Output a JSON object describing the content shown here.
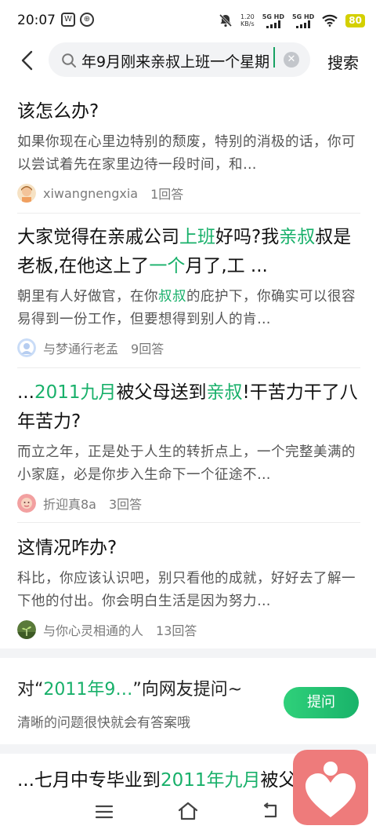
{
  "status_bar": {
    "time": "20:07",
    "speed_value": "1.20",
    "speed_unit": "KB/s",
    "sim1_label": "5G HD",
    "sim2_label": "5G HD",
    "battery": "80"
  },
  "search": {
    "query": "年9月刚来亲叔上班一个星期",
    "button_label": "搜索"
  },
  "results": [
    {
      "title": "该怎么办?",
      "summary": "如果你现在心里边特别的颓废，特别的消极的话，你可以尝试着先在家里边待一段时间，和…",
      "author": "xiwangnengxia",
      "answers": "1回答"
    },
    {
      "title_parts": [
        "大家觉得在亲戚公司",
        "上班",
        "好吗?我",
        "亲叔",
        "叔是老板,在他这上了",
        "一个",
        "月了,工 ..."
      ],
      "summary_parts": [
        "朝里有人好做官，在你",
        "叔叔",
        "的庇护下，你确实可以很容易得到一份工作，但要想得到别人的肯…"
      ],
      "author": "与梦通行老孟",
      "answers": "9回答"
    },
    {
      "title_parts": [
        "...",
        "2011九月",
        "被父母送到",
        "亲叔",
        "!干苦力干了八年苦力?"
      ],
      "summary": "而立之年，正是处于人生的转折点上，一个完整美满的小家庭，必是你步入生命下一个征途不…",
      "author": "折迎真8a",
      "answers": "3回答"
    },
    {
      "title": "这情况咋办?",
      "summary": "科比，你应该认识吧，别只看他的成就，好好去了解一下他的付出。你会明白生活是因为努力…",
      "author": "与你心灵相通的人",
      "answers": "13回答"
    }
  ],
  "ask": {
    "prefix": "对“",
    "keyword": "2011年9…",
    "suffix": "”向网友提问~",
    "subtitle": "清晰的问题很快就会有答案哦",
    "button_label": "提问"
  },
  "last_result": {
    "parts": [
      "...七月中专毕业到",
      "2011年九月",
      "被父"
    ]
  },
  "colors": {
    "accent": "#18b06a",
    "fab": "#ee7b7b"
  }
}
